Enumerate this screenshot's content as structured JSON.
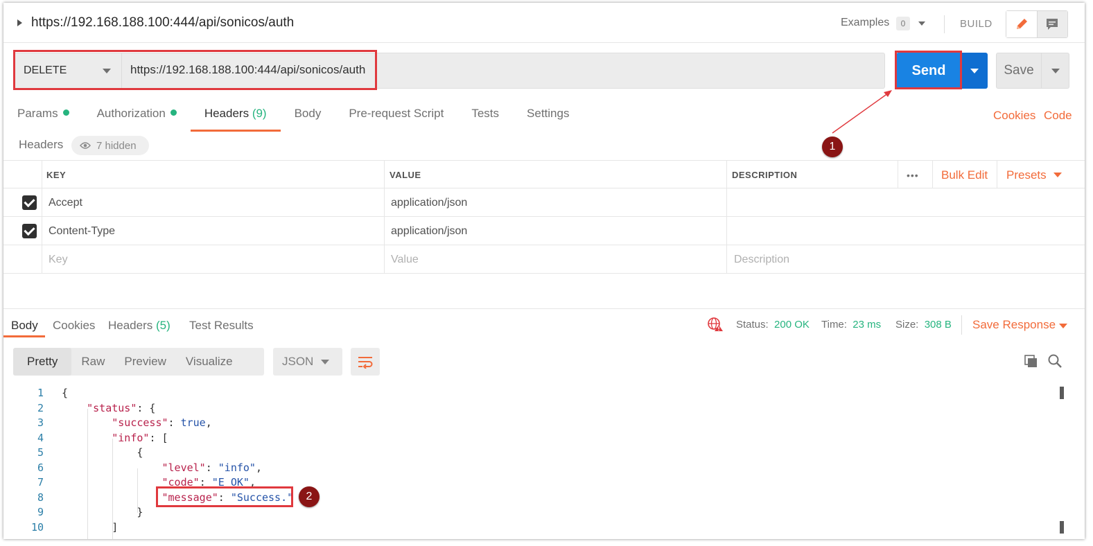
{
  "request": {
    "title": "https://192.168.188.100:444/api/sonicos/auth",
    "method": "DELETE",
    "url": "https://192.168.188.100:444/api/sonicos/auth"
  },
  "toolbar": {
    "examples_label": "Examples",
    "examples_count": "0",
    "build_label": "BUILD",
    "send_label": "Send",
    "save_label": "Save"
  },
  "request_tabs": {
    "params": "Params",
    "authorization": "Authorization",
    "headers": "Headers",
    "headers_count": "(9)",
    "body": "Body",
    "prerequest": "Pre-request Script",
    "tests": "Tests",
    "settings": "Settings"
  },
  "links": {
    "cookies": "Cookies",
    "code": "Code"
  },
  "headers_section": {
    "label": "Headers",
    "hidden": "7 hidden",
    "col_key": "KEY",
    "col_value": "VALUE",
    "col_description": "DESCRIPTION",
    "more": "•••",
    "bulk_edit": "Bulk Edit",
    "presets": "Presets",
    "rows": [
      {
        "key": "Accept",
        "value": "application/json",
        "checked": true
      },
      {
        "key": "Content-Type",
        "value": "application/json",
        "checked": true
      }
    ],
    "placeholder": {
      "key": "Key",
      "value": "Value",
      "description": "Description"
    }
  },
  "response": {
    "tabs": {
      "body": "Body",
      "cookies": "Cookies",
      "headers": "Headers",
      "headers_count": "(5)",
      "test_results": "Test Results"
    },
    "status_label": "Status:",
    "status_value": "200 OK",
    "time_label": "Time:",
    "time_value": "23 ms",
    "size_label": "Size:",
    "size_value": "308 B",
    "save_response": "Save Response",
    "views": {
      "pretty": "Pretty",
      "raw": "Raw",
      "preview": "Preview",
      "visualize": "Visualize"
    },
    "format": "JSON"
  },
  "code_lines": [
    "1",
    "2",
    "3",
    "4",
    "5",
    "6",
    "7",
    "8",
    "9",
    "10"
  ],
  "code": {
    "status_key": "\"status\"",
    "success_key": "\"success\"",
    "success_val": "true",
    "info_key": "\"info\"",
    "level_key": "\"level\"",
    "level_val": "\"info\"",
    "code_key": "\"code\"",
    "code_val": "\"E_OK\"",
    "message_key": "\"message\"",
    "message_val": "\"Success.\""
  },
  "annotations": {
    "step1": "1",
    "step2": "2"
  },
  "colors": {
    "accent": "#f26b3a",
    "send": "#1983e3",
    "green": "#26b47f",
    "highlight": "#e0393e",
    "badge": "#8a1515"
  }
}
